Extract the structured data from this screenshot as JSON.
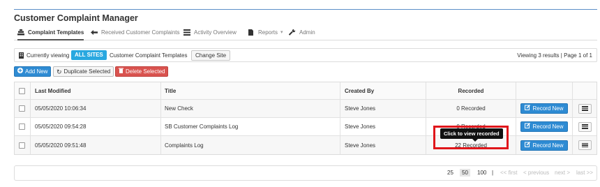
{
  "app": {
    "title": "Customer Complaint Manager"
  },
  "nav": [
    {
      "label": "Complaint Templates",
      "icon": "templates-icon",
      "active": true
    },
    {
      "label": "Received Customer Complaints",
      "icon": "arrow-left-icon"
    },
    {
      "label": "Activity Overview",
      "icon": "list-icon"
    },
    {
      "label": "Reports",
      "icon": "document-icon",
      "dropdown": true
    },
    {
      "label": "Admin",
      "icon": "wrench-icon"
    }
  ],
  "viewbar": {
    "prefix": "Currently viewing",
    "site_badge": "ALL SITES",
    "context": "Customer Complaint Templates",
    "change_site": "Change Site",
    "results": "Viewing 3 results | Page 1 of 1"
  },
  "toolbar": {
    "add": "Add New",
    "duplicate": "Duplicate Selected",
    "delete": "Delete Selected"
  },
  "table": {
    "columns": [
      "Last Modified",
      "Title",
      "Created By",
      "Recorded"
    ],
    "rows": [
      {
        "modified": "05/05/2020 10:06:34",
        "title": "New Check",
        "created_by": "Steve Jones",
        "recorded": "0 Recorded",
        "action": "Record New"
      },
      {
        "modified": "05/05/2020 09:54:28",
        "title": "SB Customer Complaints Log",
        "created_by": "Steve Jones",
        "recorded": "0 Recorded",
        "action": "Record New"
      },
      {
        "modified": "05/05/2020 09:51:48",
        "title": "Complaints Log",
        "created_by": "Steve Jones",
        "recorded": "22 Recorded",
        "action": "Record New"
      }
    ]
  },
  "tooltip": "Click to view recorded",
  "pager": {
    "sizes": [
      "25",
      "50",
      "100"
    ],
    "selected_size": "50",
    "separator": "|",
    "first": "<< first",
    "previous": "< previous",
    "next": "next >",
    "last": "last >>"
  },
  "colors": {
    "accent": "#2e8bd3",
    "badge": "#29a8e0",
    "danger": "#d9534f",
    "highlight": "#e0161b"
  }
}
